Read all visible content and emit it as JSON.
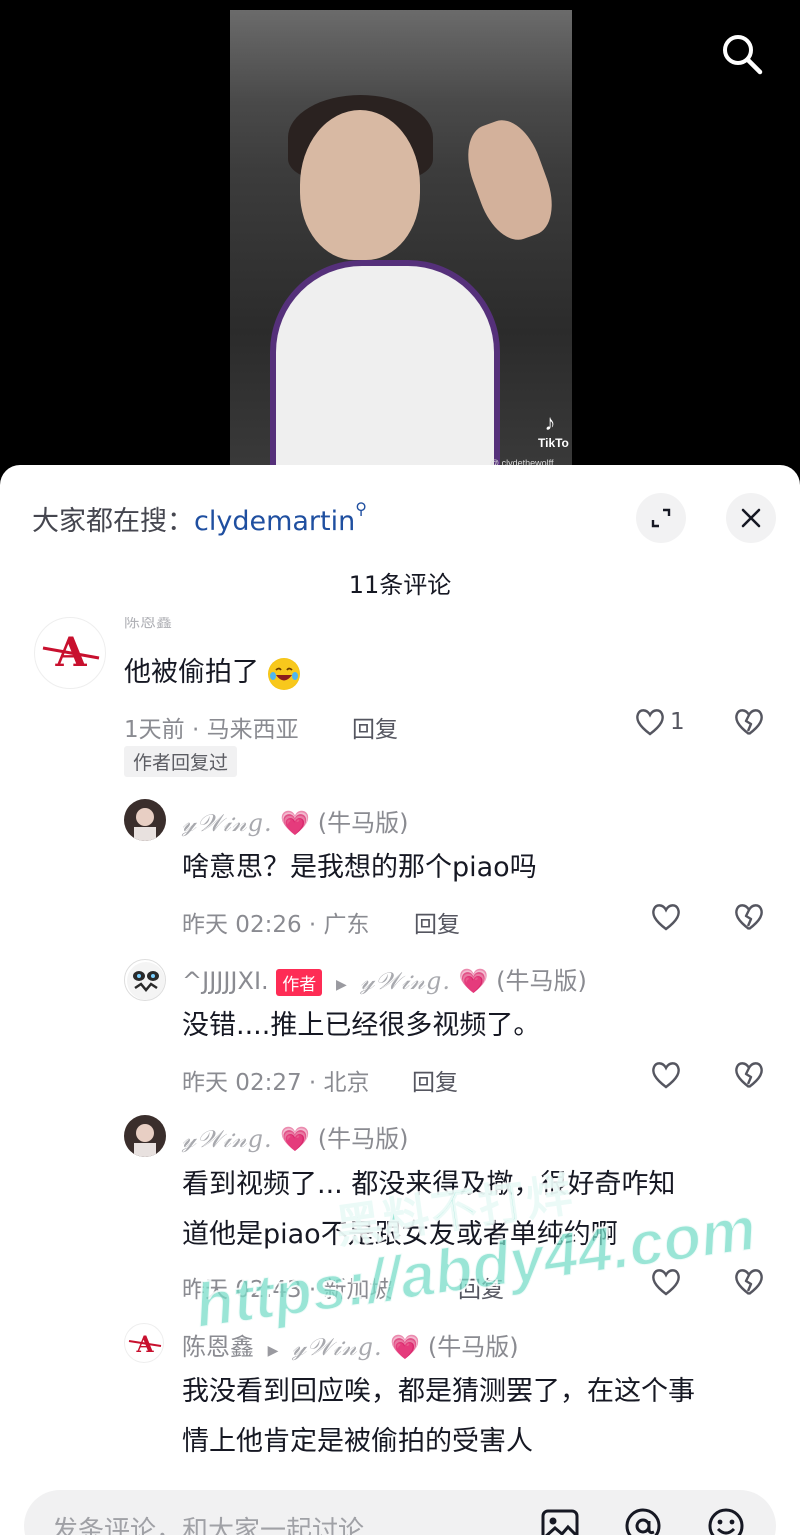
{
  "video": {
    "watermark_brand": "TikTo",
    "watermark_handle": "@ clydethewolff"
  },
  "sheet": {
    "search_prefix": "大家都在搜：",
    "search_term": "clydemartin",
    "comment_count": "11条评论"
  },
  "comments": [
    {
      "name": "陈恩鑫",
      "text": "他被偷拍了",
      "meta": "1天前 · 马来西亚",
      "reply": "回复",
      "likes": "1",
      "author_replied": "作者回复过"
    },
    {
      "name": "𝓎𝒲𝒾𝓃𝑔.",
      "tag": "(牛马版)",
      "text": "啥意思？是我想的那个piao吗",
      "meta": "昨天 02:26 · 广东",
      "reply": "回复"
    },
    {
      "name": "^JJJJJXI.",
      "badge": "作者",
      "to_name": "𝓎𝒲𝒾𝓃𝑔.",
      "to_tag": "(牛马版)",
      "text": "没错....推上已经很多视频了。",
      "meta": "昨天 02:27 · 北京",
      "reply": "回复"
    },
    {
      "name": "𝓎𝒲𝒾𝓃𝑔.",
      "tag": "(牛马版)",
      "text_line1": "看到视频了...  都没来得及撤，很好奇咋知",
      "text_line2": "道他是piao不是跟女友或者单纯约啊",
      "meta": "昨天 02:43 · 新加坡",
      "reply": "回复"
    },
    {
      "name": "陈恩鑫",
      "to_name": "𝓎𝒲𝒾𝓃𝑔.",
      "to_tag": "(牛马版)",
      "text_line1": "我没看到回应唉，都是猜测罢了，在这个事",
      "text_line2": "情上他肯定是被偷拍的受害人"
    }
  ],
  "watermark": {
    "line1": "黑料不打烊",
    "line2": "https://abdy44.com"
  },
  "input": {
    "placeholder": "发条评论，和大家一起讨论"
  },
  "colors": {
    "accent": "#fe2c55",
    "link": "#1f4fa0",
    "name_heart": "#ef4c9c"
  }
}
